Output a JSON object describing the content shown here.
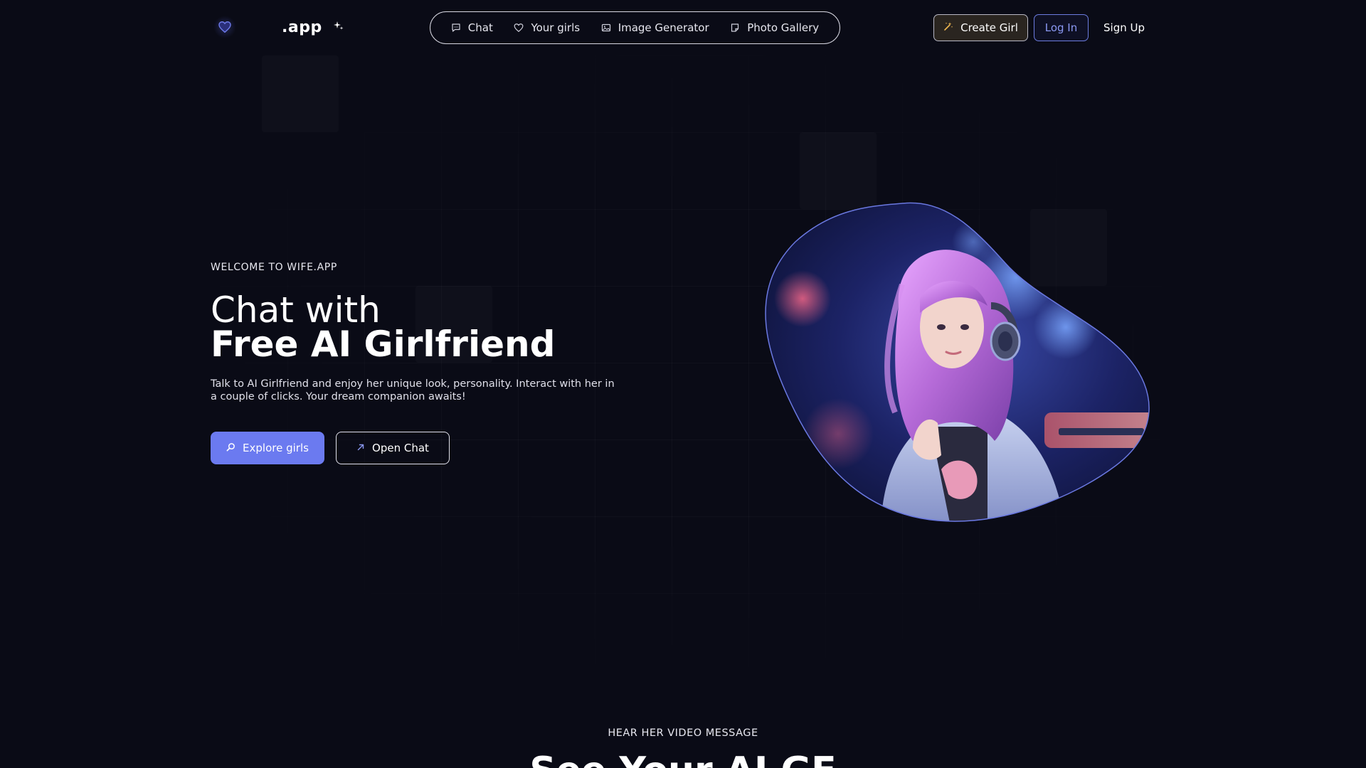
{
  "header": {
    "logo_text": ".app",
    "nav": [
      {
        "label": "Chat",
        "icon": "chat-bubble-icon"
      },
      {
        "label": "Your girls",
        "icon": "heart-icon"
      },
      {
        "label": "Image Generator",
        "icon": "image-icon"
      },
      {
        "label": "Photo Gallery",
        "icon": "gallery-icon"
      }
    ],
    "create_label": "Create Girl",
    "login_label": "Log In",
    "signup_label": "Sign Up"
  },
  "hero": {
    "eyebrow": "WELCOME TO WIFE.APP",
    "title_line1": "Chat with",
    "title_line2": "Free AI Girlfriend",
    "description": "Talk to AI Girlfriend and enjoy her unique look, personality. Interact with her in a couple of clicks. Your dream companion awaits!",
    "explore_label": "Explore girls",
    "open_chat_label": "Open Chat"
  },
  "section": {
    "eyebrow": "HEAR HER VIDEO MESSAGE",
    "title": "See Your AI GF"
  },
  "colors": {
    "background": "#0a0b16",
    "accent": "#6b7af0",
    "login_text": "#8a98f2",
    "create_bg": "#2a2520"
  }
}
